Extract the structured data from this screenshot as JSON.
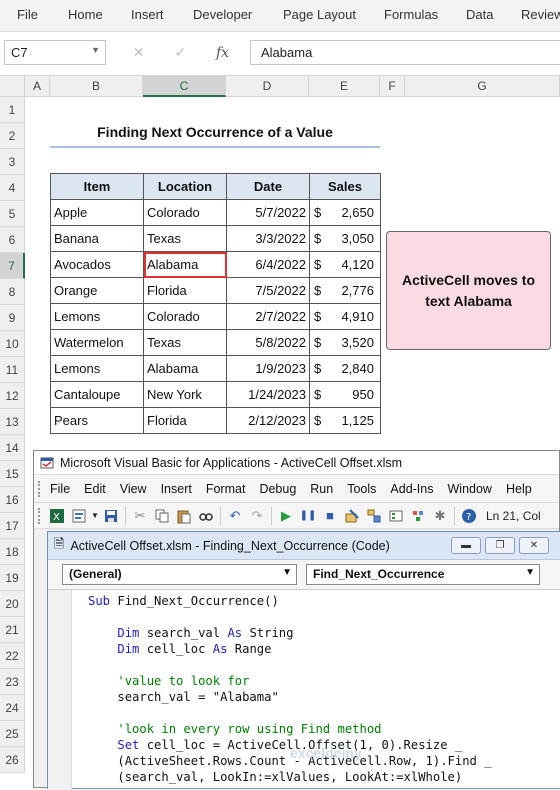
{
  "ribbon": {
    "tabs": [
      "File",
      "Home",
      "Insert",
      "Developer",
      "Page Layout",
      "Formulas",
      "Data",
      "Review"
    ]
  },
  "formula_bar": {
    "name_box": "C7",
    "formula": "Alabama"
  },
  "columns": [
    "A",
    "B",
    "C",
    "D",
    "E",
    "F",
    "G"
  ],
  "rows": [
    "1",
    "2",
    "3",
    "4",
    "5",
    "6",
    "7",
    "8",
    "9",
    "10",
    "11",
    "12",
    "13",
    "14",
    "15",
    "16",
    "17",
    "18",
    "19",
    "20",
    "21",
    "22",
    "23",
    "24",
    "25",
    "26"
  ],
  "sheet": {
    "title": "Finding Next Occurrence of a Value",
    "headers": [
      "Item",
      "Location",
      "Date",
      "Sales"
    ],
    "currency": "$",
    "rows": [
      {
        "item": "Apple",
        "location": "Colorado",
        "date": "5/7/2022",
        "sales": "2,650"
      },
      {
        "item": "Banana",
        "location": "Texas",
        "date": "3/3/2022",
        "sales": "3,050"
      },
      {
        "item": "Avocados",
        "location": "Alabama",
        "date": "6/4/2022",
        "sales": "4,120"
      },
      {
        "item": "Orange",
        "location": "Florida",
        "date": "7/5/2022",
        "sales": "2,776"
      },
      {
        "item": "Lemons",
        "location": "Colorado",
        "date": "2/7/2022",
        "sales": "4,910"
      },
      {
        "item": "Watermelon",
        "location": "Texas",
        "date": "5/8/2022",
        "sales": "3,520"
      },
      {
        "item": "Lemons",
        "location": "Alabama",
        "date": "1/9/2023",
        "sales": "2,840"
      },
      {
        "item": "Cantaloupe",
        "location": "New York",
        "date": "1/24/2023",
        "sales": "950"
      },
      {
        "item": "Pears",
        "location": "Florida",
        "date": "2/12/2023",
        "sales": "1,125"
      }
    ],
    "callout": "ActiveCell moves to text Alabama"
  },
  "vba": {
    "window_title": "Microsoft Visual Basic for Applications - ActiveCell Offset.xlsm",
    "menu": [
      "File",
      "Edit",
      "View",
      "Insert",
      "Format",
      "Debug",
      "Run",
      "Tools",
      "Add-Ins",
      "Window",
      "Help"
    ],
    "status": "Ln 21, Col",
    "code_window_title": "ActiveCell Offset.xlsm - Finding_Next_Occurrence (Code)",
    "object_dropdown": "(General)",
    "proc_dropdown": "Find_Next_Occurrence",
    "code": [
      {
        "t": "kw",
        "s": "Sub",
        "rest": " Find_Next_Occurrence()"
      },
      {
        "t": "blank"
      },
      {
        "t": "kw2",
        "indent": "    ",
        "s": "Dim",
        "mid": " search_val ",
        "s2": "As",
        "rest": " String"
      },
      {
        "t": "kw2",
        "indent": "    ",
        "s": "Dim",
        "mid": " cell_loc ",
        "s2": "As",
        "rest": " Range"
      },
      {
        "t": "blank"
      },
      {
        "t": "cm",
        "indent": "    ",
        "s": "'value to look for"
      },
      {
        "t": "plain",
        "indent": "    ",
        "s": "search_val = \"Alabama\""
      },
      {
        "t": "blank"
      },
      {
        "t": "cm",
        "indent": "    ",
        "s": "'look in every row using Find method"
      },
      {
        "t": "kw",
        "indent": "    ",
        "s": "Set",
        "rest": " cell_loc = ActiveCell.Offset(1, 0).Resize _"
      },
      {
        "t": "plain",
        "indent": "    ",
        "s": "(ActiveSheet.Rows.Count - ActiveCell.Row, 1).Find _"
      },
      {
        "t": "plain",
        "indent": "    ",
        "s": "(search_val, LookIn:=xlValues, LookAt:=xlWhole)"
      }
    ]
  },
  "watermark": "exceldemy"
}
